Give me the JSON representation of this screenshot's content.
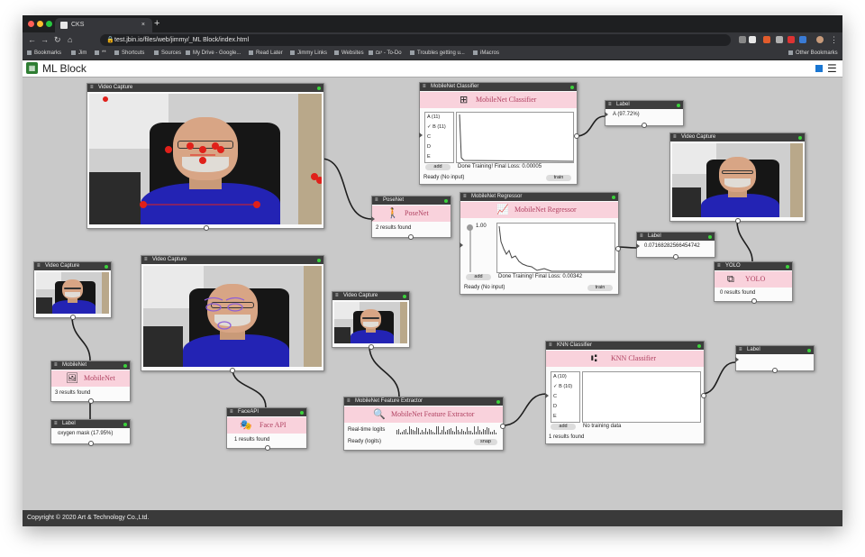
{
  "browser": {
    "tab_title": "CKS",
    "tab_close": "×",
    "new_tab": "+",
    "url": "test.jbin.io/files/web/jimmy/_ML Block/index.html",
    "nav": {
      "back": "←",
      "forward": "→",
      "reload": "↻",
      "home": "⌂",
      "lock": "🔒"
    },
    "bookmarks": [
      "Bookmarks",
      "Jim",
      "**",
      "Shortcuts",
      "Sources",
      "My Drive - Google...",
      "Read Later",
      "Jimmy Links",
      "Websites",
      "יום - To-Do",
      "Troubles getting u...",
      "iMacros"
    ],
    "other_bookmarks": "Other Bookmarks",
    "window_buttons": [
      "#ff5f57",
      "#febc2e",
      "#28c840"
    ]
  },
  "app": {
    "title": "ML Block",
    "menu_icon": "☰",
    "footer": "Copyright © 2020 Art & Technology Co.,Ltd."
  },
  "blocks": {
    "video_main": {
      "title": "Video Capture"
    },
    "posenet": {
      "title": "PoseNet",
      "label": "PoseNet",
      "status": "2 results found"
    },
    "classifier": {
      "title": "MobileNet Classifier",
      "label": "MobileNet Classifier",
      "classes": [
        "A (11)",
        "✓ B (11)",
        "C",
        "D",
        "E"
      ],
      "add": "add",
      "status_text": "Done Training! Final Loss: 0.00005",
      "ready": "Ready (No input)",
      "train": "train"
    },
    "label_top": {
      "title": "Label",
      "value": "A (97.72%)"
    },
    "video_right": {
      "title": "Video Capture"
    },
    "regressor": {
      "title": "MobileNet Regressor",
      "label": "MobileNet Regressor",
      "slider_value": "1.00",
      "add": "add",
      "status_text": "Done Training! Final Loss: 0.00342",
      "ready": "Ready (No input)",
      "train": "train"
    },
    "label_reg": {
      "title": "Label",
      "value": "0.07168282566454742"
    },
    "yolo": {
      "title": "YOLO",
      "label": "YOLO",
      "status": "0 results found"
    },
    "video_small": {
      "title": "Video Capture"
    },
    "video_mid": {
      "title": "Video Capture"
    },
    "video_center": {
      "title": "Video Capture"
    },
    "mobilenet": {
      "title": "MobileNet",
      "label": "MobileNet",
      "status": "3 results found"
    },
    "label_bottom": {
      "title": "Label",
      "value": "oxygen mask (17.95%)"
    },
    "faceapi": {
      "title": "FaceAPI",
      "label": "Face API",
      "status": "1 results found"
    },
    "feature": {
      "title": "MobileNet Feature Extractor",
      "label": "MobileNet Feature Extractor",
      "logits_label": "Real-time logits",
      "ready": "Ready (logits)",
      "snap": "snap"
    },
    "knn": {
      "title": "KNN Classifier",
      "label": "KNN Classifier",
      "classes": [
        "A (10)",
        "✓ B (10)",
        "C",
        "D",
        "E"
      ],
      "add": "add",
      "status_text": "No training data",
      "status": "1 results found"
    },
    "label_knn": {
      "title": "Label",
      "value": ""
    }
  },
  "colors": {
    "canvas": "#c9c9c9",
    "header_bar": "#3d3d3d",
    "band": "#f9d2dc",
    "status_dot": "#3bd23b",
    "accent": "#1976d2"
  },
  "icons": [
    "hamburger-icon",
    "classifier-icon",
    "person-icon",
    "chart-icon",
    "yolo-icon",
    "image-icon",
    "face-icon",
    "search-icon",
    "knn-icon"
  ]
}
